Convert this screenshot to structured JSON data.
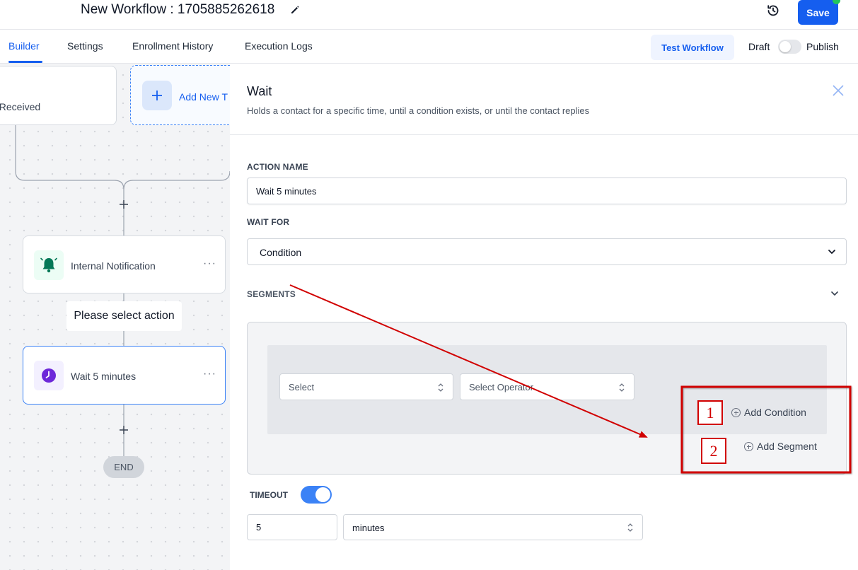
{
  "header": {
    "title": "New Workflow : 1705885262618",
    "save_label": "Save"
  },
  "tabs": [
    {
      "label": "Builder",
      "active": true
    },
    {
      "label": "Settings",
      "active": false
    },
    {
      "label": "Enrollment History",
      "active": false
    },
    {
      "label": "Execution Logs",
      "active": false
    }
  ],
  "toolbar": {
    "test_label": "Test Workflow",
    "draft_label": "Draft",
    "publish_label": "Publish",
    "published": false
  },
  "canvas": {
    "trigger_text": "t Received",
    "add_trigger_label": "Add New T",
    "notification_node": {
      "label": "Internal Notification",
      "menu": "···",
      "icon": "bell-icon"
    },
    "select_action_label": "Please select action",
    "wait_node": {
      "label": "Wait 5 minutes",
      "menu": "···",
      "icon": "clock-icon"
    },
    "end_label": "END",
    "plus_glyph": "+"
  },
  "panel": {
    "title": "Wait",
    "subtitle": "Holds a contact for a specific time, until a condition exists, or until the contact replies",
    "action_name_label": "ACTION NAME",
    "action_name_value": "Wait 5 minutes",
    "wait_for_label": "WAIT FOR",
    "wait_for_value": "Condition",
    "segments_label": "SEGMENTS",
    "condition": {
      "field_placeholder": "Select",
      "operator_placeholder": "Select Operator"
    },
    "add_condition_label": "Add Condition",
    "add_segment_label": "Add Segment",
    "timeout_label": "TIMEOUT",
    "timeout_enabled": true,
    "timeout_value": "5",
    "timeout_unit": "minutes"
  },
  "annotations": {
    "badge_1": "1",
    "badge_2": "2",
    "color": "#d10000"
  },
  "colors": {
    "accent": "#155eef",
    "toggle_on": "#3b82f6",
    "notification_icon": "#10b981",
    "wait_icon": "#7c3aed"
  }
}
